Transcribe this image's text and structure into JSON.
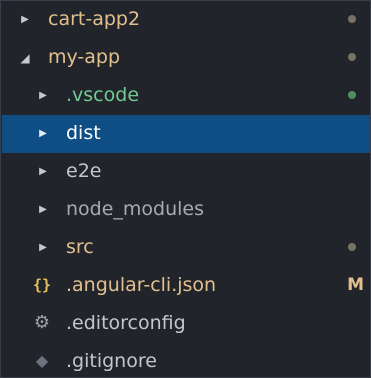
{
  "colors": {
    "background": "#21252b",
    "selection": "#0f4d85",
    "modified": "#e2c08d",
    "untracked": "#73c991",
    "ignored_dot": "#6f6a5e",
    "text": "#d3d6db",
    "icon_braces": "#e6c35c",
    "icon_gear": "#9ea2a8",
    "icon_diamond": "#6b7280"
  },
  "tree": {
    "items": [
      {
        "label": "cart-app2",
        "kind": "folder",
        "expanded": false,
        "status": "dot-modified"
      },
      {
        "label": "my-app",
        "kind": "folder",
        "expanded": true,
        "status": "dot-modified"
      },
      {
        "label": ".vscode",
        "kind": "folder",
        "expanded": false,
        "status": "dot-untracked"
      },
      {
        "label": "dist",
        "kind": "folder",
        "expanded": false,
        "selected": true
      },
      {
        "label": "e2e",
        "kind": "folder",
        "expanded": false
      },
      {
        "label": "node_modules",
        "kind": "folder",
        "expanded": false
      },
      {
        "label": "src",
        "kind": "folder",
        "expanded": false,
        "status": "dot-modified"
      },
      {
        "label": ".angular-cli.json",
        "kind": "file",
        "icon": "json-braces-icon",
        "status": "M"
      },
      {
        "label": ".editorconfig",
        "kind": "file",
        "icon": "gear-icon"
      },
      {
        "label": ".gitignore",
        "kind": "file",
        "icon": "git-diamond-icon"
      }
    ]
  },
  "glyphs": {
    "collapsed": "▶",
    "expanded": "◢",
    "braces": "{}",
    "gear": "⚙",
    "diamond": "◆"
  }
}
